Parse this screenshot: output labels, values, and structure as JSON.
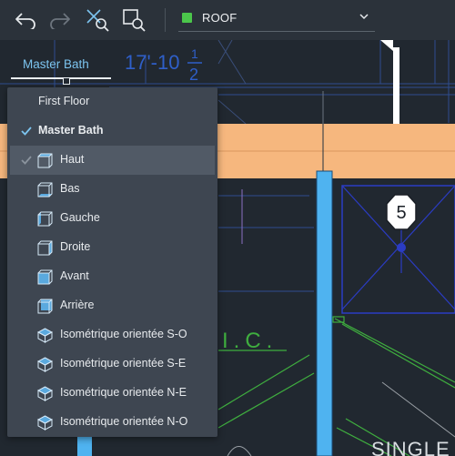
{
  "toolbar": {
    "layer": {
      "name": "ROOF",
      "swatch_color": "#4bc64b"
    }
  },
  "view_tab": {
    "label": "Master Bath"
  },
  "drawing": {
    "dimension_text_main": "17'-10",
    "dimension_fraction_num": "1",
    "dimension_fraction_den": "2",
    "marker_number": "5",
    "room_label": "I.C.",
    "bottom_label": "SINGLE"
  },
  "view_menu": {
    "items": [
      {
        "label": "First Floor",
        "icon": "none",
        "checked": false,
        "bold": false,
        "highlighted": false
      },
      {
        "label": "Master Bath",
        "icon": "none",
        "checked": true,
        "bold": true,
        "highlighted": false
      },
      {
        "label": "Haut",
        "icon": "view-cube-top-icon",
        "checked": true,
        "bold": false,
        "highlighted": true
      },
      {
        "label": "Bas",
        "icon": "view-cube-bottom-icon",
        "checked": false,
        "bold": false,
        "highlighted": false
      },
      {
        "label": "Gauche",
        "icon": "view-cube-left-icon",
        "checked": false,
        "bold": false,
        "highlighted": false
      },
      {
        "label": "Droite",
        "icon": "view-cube-right-icon",
        "checked": false,
        "bold": false,
        "highlighted": false
      },
      {
        "label": "Avant",
        "icon": "view-cube-front-icon",
        "checked": false,
        "bold": false,
        "highlighted": false
      },
      {
        "label": "Arrière",
        "icon": "view-cube-back-icon",
        "checked": false,
        "bold": false,
        "highlighted": false
      },
      {
        "label": "Isométrique orientée S-O",
        "icon": "iso-sw-icon",
        "checked": false,
        "bold": false,
        "highlighted": false
      },
      {
        "label": "Isométrique orientée S-E",
        "icon": "iso-se-icon",
        "checked": false,
        "bold": false,
        "highlighted": false
      },
      {
        "label": "Isométrique orientée N-E",
        "icon": "iso-ne-icon",
        "checked": false,
        "bold": false,
        "highlighted": false
      },
      {
        "label": "Isométrique orientée N-O",
        "icon": "iso-nw-icon",
        "checked": false,
        "bold": false,
        "highlighted": false
      }
    ]
  },
  "colors": {
    "accent": "#7cc4ef",
    "background": "#212830",
    "beam": "#f6b77e",
    "column": "#4fb3f0"
  }
}
